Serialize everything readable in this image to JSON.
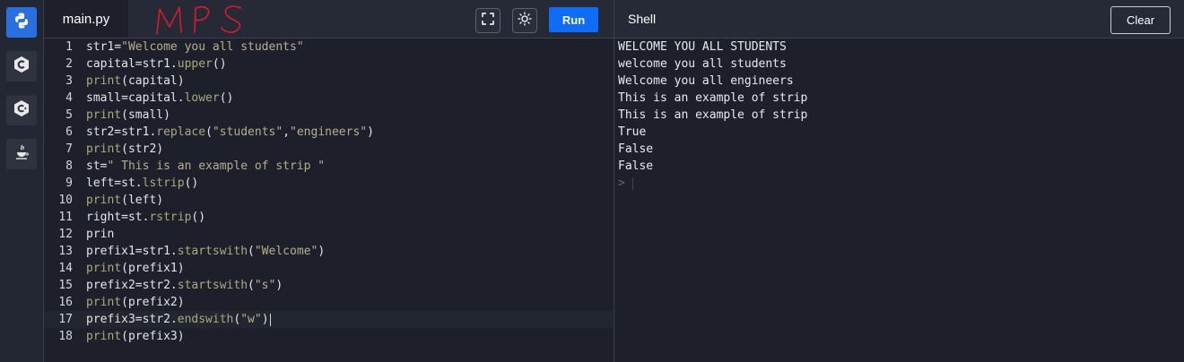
{
  "sidebar": {
    "items": [
      {
        "name": "python",
        "active": true
      },
      {
        "name": "c",
        "active": false
      },
      {
        "name": "cpp",
        "active": false
      },
      {
        "name": "java",
        "active": false
      }
    ]
  },
  "editor": {
    "tab_label": "main.py",
    "annotation": "MPS",
    "run_label": "Run",
    "lines": [
      [
        {
          "t": "id",
          "v": "str1"
        },
        {
          "t": "id",
          "v": "="
        },
        {
          "t": "str",
          "v": "\"Welcome you all students\""
        }
      ],
      [
        {
          "t": "id",
          "v": "capital=str1."
        },
        {
          "t": "fn",
          "v": "upper"
        },
        {
          "t": "id",
          "v": "()"
        }
      ],
      [
        {
          "t": "fn",
          "v": "print"
        },
        {
          "t": "id",
          "v": "(capital)"
        }
      ],
      [
        {
          "t": "id",
          "v": "small=capital."
        },
        {
          "t": "fn",
          "v": "lower"
        },
        {
          "t": "id",
          "v": "()"
        }
      ],
      [
        {
          "t": "fn",
          "v": "print"
        },
        {
          "t": "id",
          "v": "(small)"
        }
      ],
      [
        {
          "t": "id",
          "v": "str2=str1."
        },
        {
          "t": "fn",
          "v": "replace"
        },
        {
          "t": "id",
          "v": "("
        },
        {
          "t": "str",
          "v": "\"students\""
        },
        {
          "t": "id",
          "v": ","
        },
        {
          "t": "str",
          "v": "\"engineers\""
        },
        {
          "t": "id",
          "v": ")"
        }
      ],
      [
        {
          "t": "fn",
          "v": "print"
        },
        {
          "t": "id",
          "v": "(str2)"
        }
      ],
      [
        {
          "t": "id",
          "v": "st="
        },
        {
          "t": "str",
          "v": "\" This is an example of strip \""
        }
      ],
      [
        {
          "t": "id",
          "v": "left=st."
        },
        {
          "t": "fn",
          "v": "lstrip"
        },
        {
          "t": "id",
          "v": "()"
        }
      ],
      [
        {
          "t": "fn",
          "v": "print"
        },
        {
          "t": "id",
          "v": "(left)"
        }
      ],
      [
        {
          "t": "id",
          "v": "right=st."
        },
        {
          "t": "fn",
          "v": "rstrip"
        },
        {
          "t": "id",
          "v": "()"
        }
      ],
      [
        {
          "t": "id",
          "v": "prin"
        }
      ],
      [
        {
          "t": "id",
          "v": "prefix1=str1."
        },
        {
          "t": "fn",
          "v": "startswith"
        },
        {
          "t": "id",
          "v": "("
        },
        {
          "t": "str",
          "v": "\"Welcome\""
        },
        {
          "t": "id",
          "v": ")"
        }
      ],
      [
        {
          "t": "fn",
          "v": "print"
        },
        {
          "t": "id",
          "v": "(prefix1)"
        }
      ],
      [
        {
          "t": "id",
          "v": "prefix2=str2."
        },
        {
          "t": "fn",
          "v": "startswith"
        },
        {
          "t": "id",
          "v": "("
        },
        {
          "t": "str",
          "v": "\"s\""
        },
        {
          "t": "id",
          "v": ")"
        }
      ],
      [
        {
          "t": "fn",
          "v": "print"
        },
        {
          "t": "id",
          "v": "(prefix2)"
        }
      ],
      [
        {
          "t": "id",
          "v": "prefix3=str2."
        },
        {
          "t": "fn",
          "v": "endswith"
        },
        {
          "t": "id",
          "v": "("
        },
        {
          "t": "str",
          "v": "\"w\""
        },
        {
          "t": "id",
          "v": ")"
        }
      ],
      [
        {
          "t": "fn",
          "v": "print"
        },
        {
          "t": "id",
          "v": "(prefix3)"
        }
      ]
    ],
    "current_line": 17
  },
  "shell": {
    "title": "Shell",
    "clear_label": "Clear",
    "output": [
      "WELCOME YOU ALL STUDENTS",
      "welcome you all students",
      "Welcome you all engineers",
      "This is an example of strip",
      "This is an example of strip",
      "True",
      "False",
      "False"
    ],
    "prompt": ">"
  },
  "colors": {
    "accent": "#0e6cf6",
    "background": "#1d202a",
    "string": "#b8ae8d",
    "function": "#a9aa7c",
    "annotation": "#d81b2a"
  }
}
